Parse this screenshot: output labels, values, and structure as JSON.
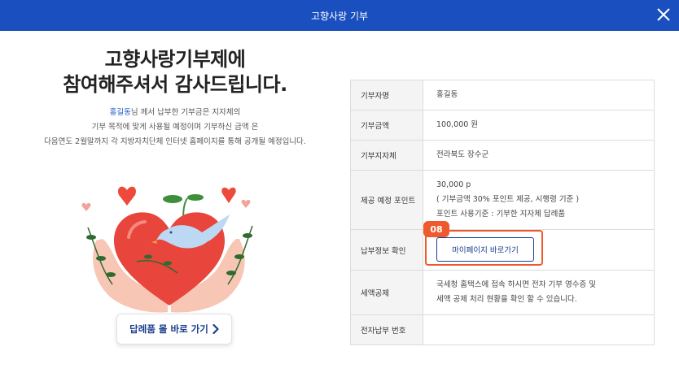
{
  "header": {
    "title": "고향사랑 기부",
    "close_icon": "close-icon"
  },
  "left": {
    "headline_line1": "고향사랑기부제에",
    "headline_line2": "참여해주셔서 감사드립니다.",
    "desc_name": "홍길동",
    "desc_line1_rest": "님 께서 납부한 기부금은 지자체의",
    "desc_line2": "기부 목적에 맞게 사용될 예정이며 기부하신 금액 은",
    "desc_line3": "다음연도 2월말까지 각 지방자치단체 인터넷 홈페이지를 통해 공개될 예정입니다.",
    "gift_button_label": "답례품 몰 바로 가기",
    "accent_color": "#1a56c7",
    "illustration": "hands-holding-heart-with-dove"
  },
  "table": {
    "donor_name_label": "기부자명",
    "donor_name_value": "홍길동",
    "amount_label": "기부금액",
    "amount_value": "100,000 원",
    "region_label": "기부지자체",
    "region_value": "전라북도 장수군",
    "points_label": "제공 예정 포인트",
    "points_value": "30,000 p",
    "points_note1": "( 기부금액 30% 포인트 제공, 시행령 기준 )",
    "points_note2": "포인트 사용기준 : 기부한 지자체 답례품",
    "payment_label": "납부정보 확인",
    "mypage_button": "마이페이지 바로가기",
    "step_badge": "08",
    "tax_label": "세액공제",
    "tax_line1": "국세청 홈택스에 접속 하시면 전자 기부 영수증 및",
    "tax_line2": "세액 공제 처리 현황을 확인 할 수 있습니다.",
    "epay_label": "전자납부 번호",
    "epay_value": ""
  },
  "colors": {
    "header_bg": "#1a4fbf",
    "highlight": "#ee5a2e",
    "button_text": "#1a3d8f"
  }
}
